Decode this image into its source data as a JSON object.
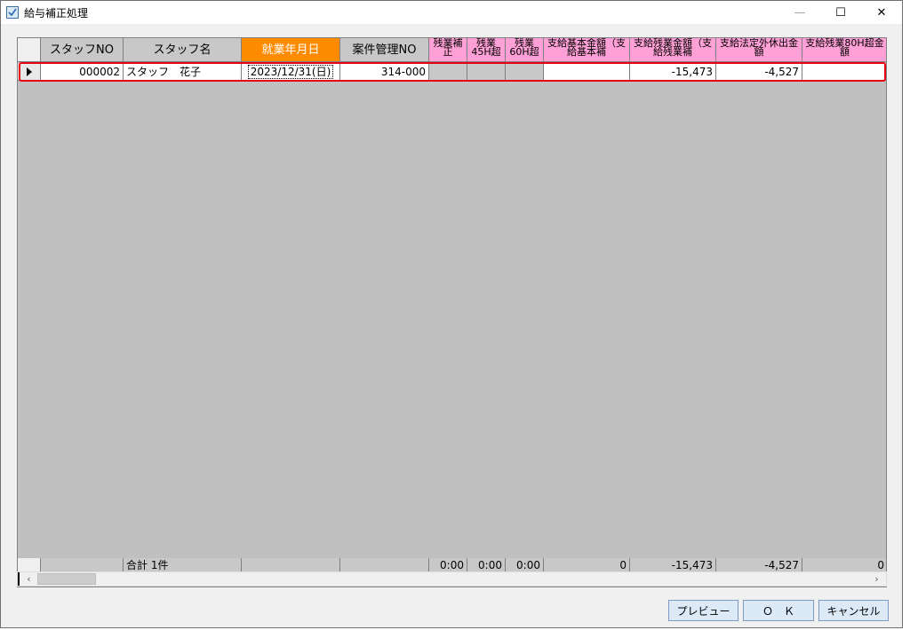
{
  "window": {
    "title": "給与補正処理"
  },
  "titlebar_buttons": {
    "minimize": "—",
    "maximize": "☐",
    "close": "✕"
  },
  "columns": [
    {
      "key": "staff_no",
      "label": "スタッフNO"
    },
    {
      "key": "staff_name",
      "label": "スタッフ名"
    },
    {
      "key": "work_date",
      "label": "就業年月日"
    },
    {
      "key": "case_no",
      "label": "案件管理NO"
    },
    {
      "key": "ot_adjust",
      "label": "残業補正"
    },
    {
      "key": "ot_45h",
      "label": "残業45H超"
    },
    {
      "key": "ot_60h",
      "label": "残業60H超"
    },
    {
      "key": "base_amount",
      "label": "支給基本金額（支給基本補"
    },
    {
      "key": "ot_amount",
      "label": "支給残業金額（支給残業補"
    },
    {
      "key": "holiday_amount",
      "label": "支給法定外休出金額"
    },
    {
      "key": "ot80_amount",
      "label": "支給残業80H超金額"
    }
  ],
  "rows": [
    {
      "staff_no": "000002",
      "staff_name": "スタッフ　花子",
      "work_date": "2023/12/31(日)",
      "case_no": "314-000",
      "ot_adjust": "",
      "ot_45h": "",
      "ot_60h": "",
      "base_amount": "",
      "ot_amount": "-15,473",
      "holiday_amount": "-4,527",
      "ot80_amount": ""
    }
  ],
  "totals": {
    "label": "合計 1件",
    "ot_adjust": "0:00",
    "ot_45h": "0:00",
    "ot_60h": "0:00",
    "base_amount": "0",
    "ot_amount": "-15,473",
    "holiday_amount": "-4,527",
    "ot80_amount": "0"
  },
  "scrollbar": {
    "left": "‹",
    "right": "›"
  },
  "buttons": {
    "preview": "プレビュー",
    "ok": "Ｏ　Ｋ",
    "cancel": "キャンセル"
  }
}
